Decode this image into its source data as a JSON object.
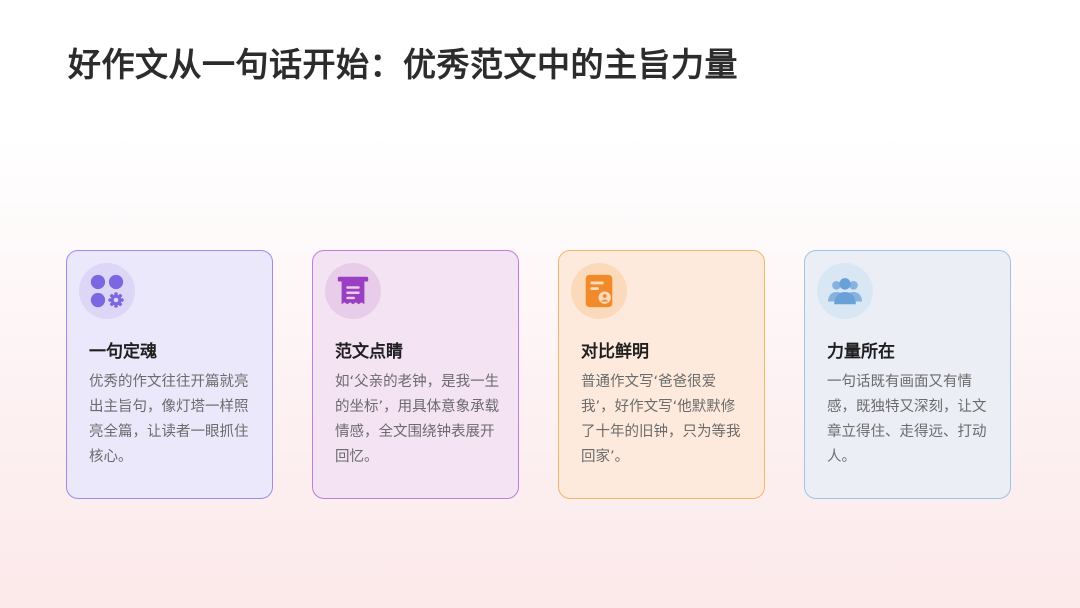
{
  "slide": {
    "title": "好作文从一句话开始：优秀范文中的主旨力量"
  },
  "cards": [
    {
      "title": "一句定魂",
      "body": "优秀的作文往往开篇就亮出主旨句，像灯塔一样照亮全篇，让读者一眼抓住核心。",
      "icon": "apps-gear-icon",
      "accent": "#7b68e0",
      "border": "#9b8de8",
      "background": "#ece8fb",
      "icon_background": "#ddd6f7"
    },
    {
      "title": "范文点睛",
      "body": "如‘父亲的老钟，是我一生的坐标’，用具体意象承载情感，全文围绕钟表展开回忆。",
      "icon": "document-stack-icon",
      "accent": "#9b3fc2",
      "border": "#c07ddc",
      "background": "#f3e3f3",
      "icon_background": "#e8cdea"
    },
    {
      "title": "对比鲜明",
      "body": "普通作文写‘爸爸很爱我’，好作文写‘他默默修了十年的旧钟，只为等我回家’。",
      "icon": "profile-document-icon",
      "accent": "#f08a2a",
      "border": "#f5b46e",
      "background": "#fdeadd",
      "icon_background": "#fbd9bb"
    },
    {
      "title": "力量所在",
      "body": "一句话既有画面又有情感，既独特又深刻，让文章立得住、走得远、打动人。",
      "icon": "users-icon",
      "accent": "#6aa0d8",
      "border": "#9cc4ec",
      "background": "#eceef6",
      "icon_background": "#d9e6f4"
    }
  ]
}
